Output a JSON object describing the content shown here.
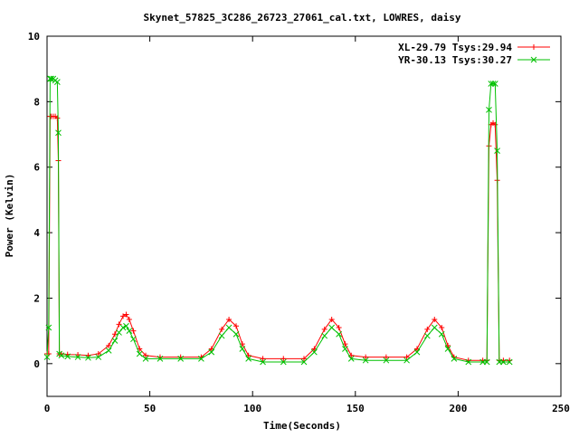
{
  "chart_data": {
    "type": "line",
    "title": "Skynet_57825_3C286_26723_27061_cal.txt, LOWRES, daisy",
    "xlabel": "Time(Seconds)",
    "ylabel": "Power (Kelvin)",
    "xlim": [
      0,
      250
    ],
    "ylim": [
      -1,
      10
    ],
    "x_ticks": [
      "0",
      "50",
      "100",
      "150",
      "200",
      "250"
    ],
    "y_ticks": [
      "0",
      "2",
      "4",
      "6",
      "8",
      "10"
    ],
    "grid": false,
    "legend_position": "top-right",
    "series": [
      {
        "name": "XL-29.79 Tsys:29.94",
        "color": "#ff0000",
        "marker": "plus",
        "x": [
          0,
          0.8,
          1.5,
          2,
          3,
          4,
          5,
          5.5,
          6,
          7,
          10,
          15,
          20,
          25,
          30,
          33,
          35,
          37,
          38.5,
          40,
          42,
          45,
          48,
          55,
          65,
          75,
          80,
          85,
          88.5,
          92,
          95,
          98,
          105,
          115,
          125,
          130,
          135,
          138.5,
          142,
          145,
          148,
          155,
          165,
          175,
          180,
          185,
          188.5,
          192,
          195,
          198,
          205,
          212,
          214,
          215,
          216,
          217,
          218,
          219,
          220,
          222,
          225
        ],
        "values": [
          0.3,
          0.3,
          7.55,
          7.55,
          7.55,
          7.55,
          7.5,
          6.2,
          0.3,
          0.3,
          0.28,
          0.27,
          0.25,
          0.3,
          0.55,
          0.9,
          1.2,
          1.45,
          1.5,
          1.35,
          1.0,
          0.45,
          0.25,
          0.2,
          0.2,
          0.2,
          0.45,
          1.05,
          1.35,
          1.15,
          0.6,
          0.25,
          0.15,
          0.15,
          0.15,
          0.45,
          1.05,
          1.35,
          1.1,
          0.6,
          0.25,
          0.2,
          0.2,
          0.2,
          0.45,
          1.05,
          1.35,
          1.1,
          0.55,
          0.2,
          0.1,
          0.1,
          0.1,
          6.65,
          7.3,
          7.35,
          7.3,
          5.6,
          0.1,
          0.1,
          0.1
        ]
      },
      {
        "name": "YR-30.13 Tsys:30.27",
        "color": "#00c000",
        "marker": "cross",
        "x": [
          0,
          0.8,
          1.5,
          2,
          3,
          4,
          5,
          5.5,
          6,
          7,
          10,
          15,
          20,
          25,
          30,
          33,
          35,
          37,
          38.5,
          40,
          42,
          45,
          48,
          55,
          65,
          75,
          80,
          85,
          88.5,
          92,
          95,
          98,
          105,
          115,
          125,
          130,
          135,
          138.5,
          142,
          145,
          148,
          155,
          165,
          175,
          180,
          185,
          188.5,
          192,
          195,
          198,
          205,
          212,
          214,
          215,
          216,
          217,
          218,
          219,
          220,
          222,
          225
        ],
        "values": [
          0.2,
          1.1,
          8.7,
          8.7,
          8.7,
          8.65,
          8.6,
          7.05,
          0.3,
          0.25,
          0.22,
          0.2,
          0.18,
          0.2,
          0.4,
          0.7,
          0.95,
          1.1,
          1.15,
          1.0,
          0.75,
          0.3,
          0.15,
          0.15,
          0.15,
          0.15,
          0.35,
          0.85,
          1.1,
          0.9,
          0.45,
          0.15,
          0.05,
          0.05,
          0.05,
          0.35,
          0.85,
          1.1,
          0.9,
          0.45,
          0.15,
          0.1,
          0.1,
          0.1,
          0.35,
          0.85,
          1.1,
          0.9,
          0.45,
          0.15,
          0.05,
          0.05,
          0.05,
          7.75,
          8.55,
          8.55,
          8.55,
          6.5,
          0.05,
          0.05,
          0.05
        ]
      }
    ]
  }
}
